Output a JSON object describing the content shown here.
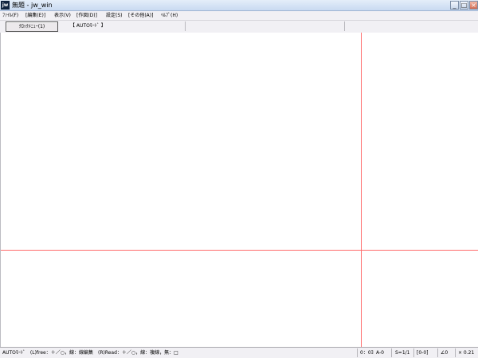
{
  "window": {
    "title": "無題 - jw_win",
    "app_icon_text": "jw",
    "controls": {
      "minimize": "_",
      "maximize": "□",
      "close": "×"
    }
  },
  "menubar": {
    "items": [
      "ﾌｧｲﾙ(F)",
      "[編集(E)]",
      "表示(V)",
      "[作図(D)]",
      "設定(S)",
      "[その他(A)]",
      "ﾍﾙﾌﾟ(H)"
    ]
  },
  "toolbar": {
    "clock_menu_label": "ｸﾛｯｸﾒﾆｭｰ(1)",
    "mode_label": "【 AUTOﾓｰﾄﾞ 】"
  },
  "canvas": {
    "guide_color": "#ff6a6a"
  },
  "statusbar": {
    "message": "AUTOﾓｰﾄﾞ　(L)free：＋／○，線：線編集　(R)Read：＋／○，線：複線，無：□",
    "scale": "0：0ﾖ",
    "drawing": "A-0",
    "layer": "S=1/1",
    "group": "[0-0]",
    "angle": "∠0",
    "zoom": "× 0.21"
  }
}
